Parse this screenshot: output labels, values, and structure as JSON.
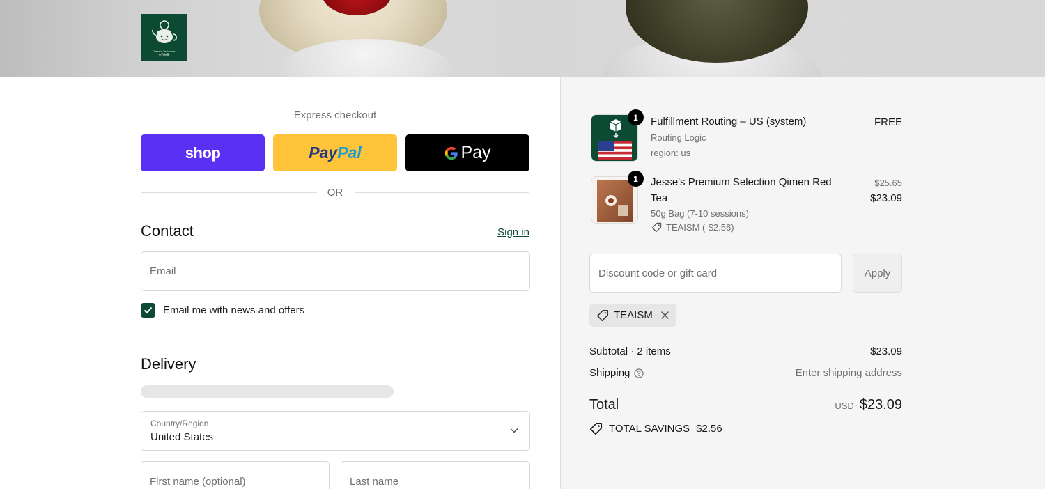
{
  "banner": {
    "logo_text_1": "Jesse's Teahouse",
    "logo_text_2": "杰西茶屋"
  },
  "express": {
    "title": "Express checkout",
    "shop_label": "shop",
    "paypal_1": "Pay",
    "paypal_2": "Pal",
    "gpay_label": "Pay",
    "or": "OR"
  },
  "contact": {
    "heading": "Contact",
    "sign_in": "Sign in",
    "email_placeholder": "Email",
    "newsletter_label": "Email me with news and offers",
    "newsletter_checked": true
  },
  "delivery": {
    "heading": "Delivery",
    "country_label": "Country/Region",
    "country_value": "United States",
    "first_name_placeholder": "First name (optional)",
    "last_name_placeholder": "Last name"
  },
  "cart": {
    "items": [
      {
        "qty": "1",
        "title": "Fulfillment Routing – US (system)",
        "sub1": "Routing Logic",
        "sub2": "region: us",
        "price": "FREE"
      },
      {
        "qty": "1",
        "title_line1": "Jesse's Premium Selection Qimen Red",
        "title_line2": "Tea",
        "variant": "50g Bag (7-10 sessions)",
        "discount": "TEAISM (-$2.56)",
        "original_price": "$25.65",
        "price": "$23.09"
      }
    ],
    "discount_placeholder": "Discount code or gift card",
    "apply_label": "Apply",
    "applied_code": "TEAISM",
    "subtotal_label": "Subtotal · 2 items",
    "subtotal_value": "$23.09",
    "shipping_label": "Shipping",
    "shipping_value": "Enter shipping address",
    "total_label": "Total",
    "total_currency": "USD",
    "total_value": "$23.09",
    "savings_label": "TOTAL SAVINGS",
    "savings_value": "$2.56"
  },
  "colors": {
    "brand_green": "#0d4a33",
    "shop_purple": "#5a31f4",
    "paypal_yellow": "#ffc439"
  }
}
